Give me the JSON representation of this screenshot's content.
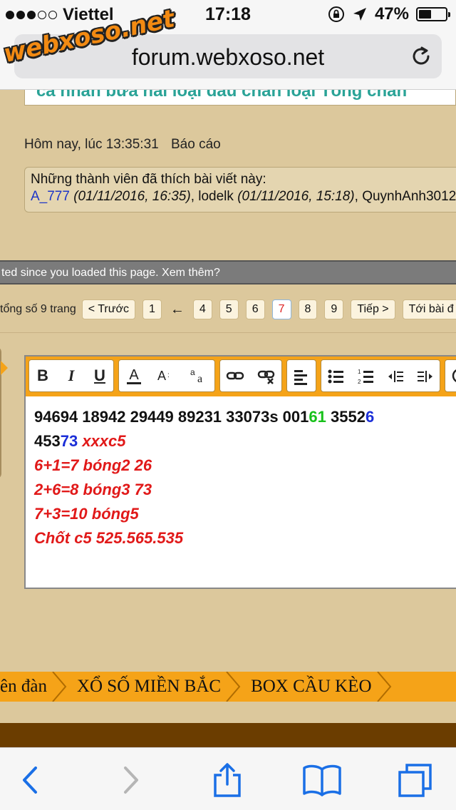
{
  "status": {
    "carrier": "Viettel",
    "time": "17:18",
    "battery_pct": "47%",
    "battery_level": 0.47
  },
  "browser": {
    "url": "forum.webxoso.net",
    "watermark": "webxoso.net"
  },
  "post": {
    "prev_snippet": "cá nhân bừa hai loại đầu chẵn loại Tổng chẵn",
    "timestamp": "Hôm nay, lúc 13:35:31",
    "report_label": "Báo cáo",
    "likes_title": "Những thành viên đã thích bài viết này:",
    "likes": [
      {
        "user": "A_777",
        "date": "(01/11/2016, 16:35)"
      },
      {
        "user": "lodelk",
        "date": "(01/11/2016, 15:18)"
      },
      {
        "user": "QuynhAnh3012",
        "date": ""
      }
    ]
  },
  "notice": "ted since you loaded this page. Xem thêm?",
  "pager": {
    "label": "tổng số 9 trang",
    "prev": "< Trước",
    "first": "1",
    "gap": "←",
    "pages": [
      "4",
      "5",
      "6",
      "7",
      "8",
      "9"
    ],
    "current": "7",
    "next": "Tiếp >",
    "last": "Tới bài đ"
  },
  "editor": {
    "toolbar": {
      "bold": "B",
      "italic": "I",
      "underline": "U"
    },
    "lines": {
      "l1_a": "94694 18942 29449 89231 33073s 001",
      "l1_b": "61",
      "l1_c": " 3552",
      "l1_d": "6",
      "l2_a": "453",
      "l2_b": "73",
      "l2_c": " xxxc5",
      "l3": "6+1=7 bóng2 26",
      "l4": "2+6=8 bóng3 73",
      "l5": "7+3=10 bóng5",
      "l6": "Chốt c5 525.565.535"
    }
  },
  "breadcrumbs": [
    "ên đàn",
    "XỔ SỐ MIỀN BẮC",
    "BOX CẦU KÈO"
  ],
  "colors": {
    "accent_orange": "#f5a318",
    "page_bg": "#dcc89c",
    "brown": "#6b3d00",
    "ios_blue": "#1a6fe6"
  }
}
